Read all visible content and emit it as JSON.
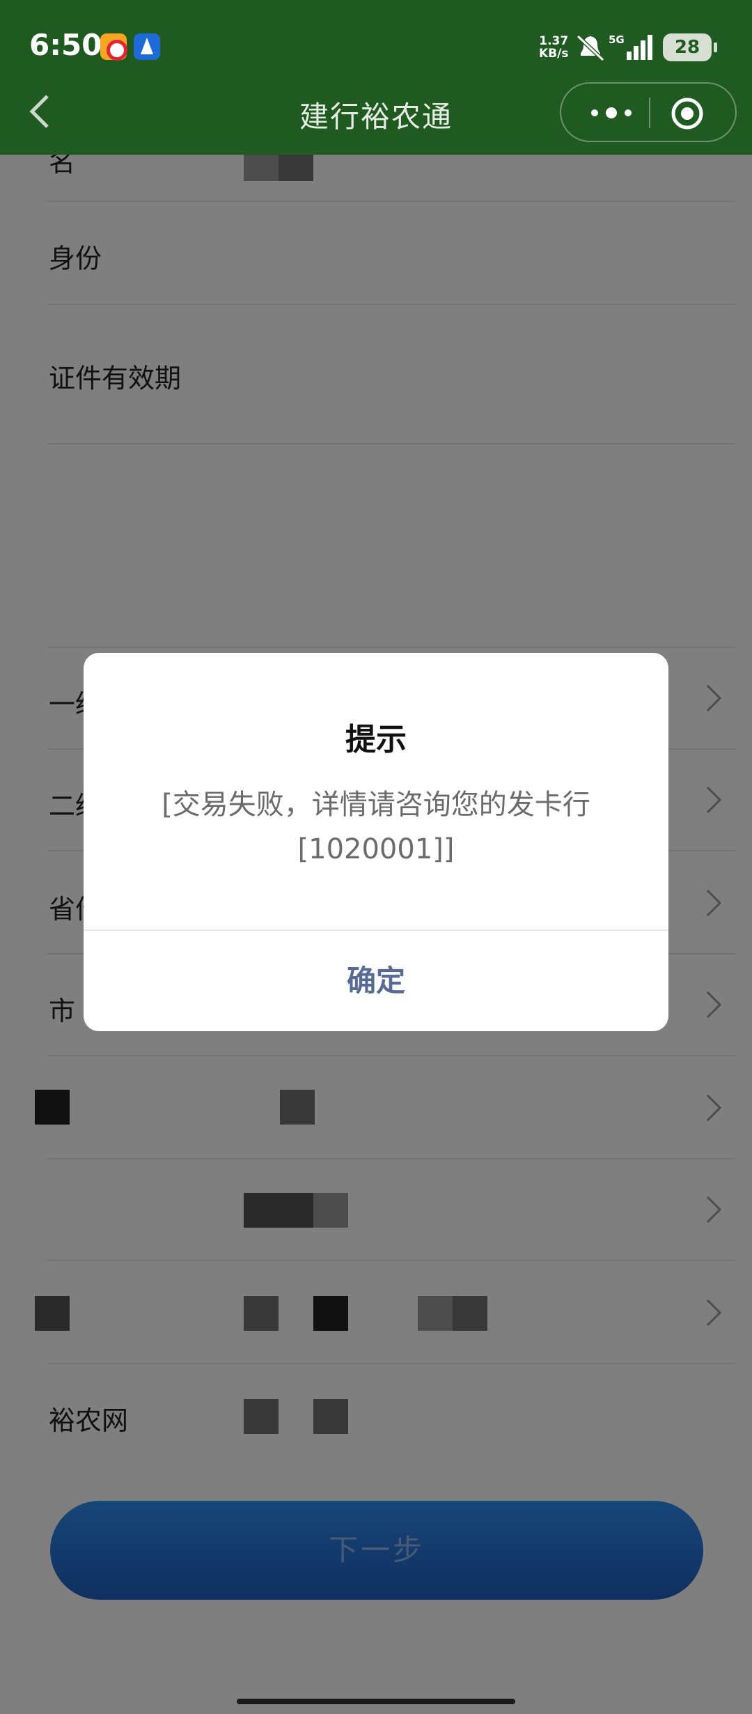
{
  "status_bar": {
    "time": "6:50",
    "net_speed_value": "1.37",
    "net_speed_unit": "KB/s",
    "network_type": "5G",
    "battery": "28"
  },
  "nav": {
    "title": "建行裕农通"
  },
  "form": {
    "rows": [
      {
        "label": "名"
      },
      {
        "label": "身份"
      },
      {
        "label": "证件有效期"
      },
      {
        "label": "一级"
      },
      {
        "label": "二级"
      },
      {
        "label": "省份"
      },
      {
        "label": "市"
      },
      {
        "label": ""
      },
      {
        "label": ""
      },
      {
        "label": ""
      },
      {
        "label": "裕农网"
      }
    ],
    "next_button": "下一步"
  },
  "dialog": {
    "title": "提示",
    "message": "[交易失败，详情请咨询您的发卡行[1020001]]",
    "confirm": "确定"
  },
  "colors": {
    "header": "#1f5a20",
    "dialog_confirm": "#576b95",
    "primary_button": "#2e8cf0"
  }
}
